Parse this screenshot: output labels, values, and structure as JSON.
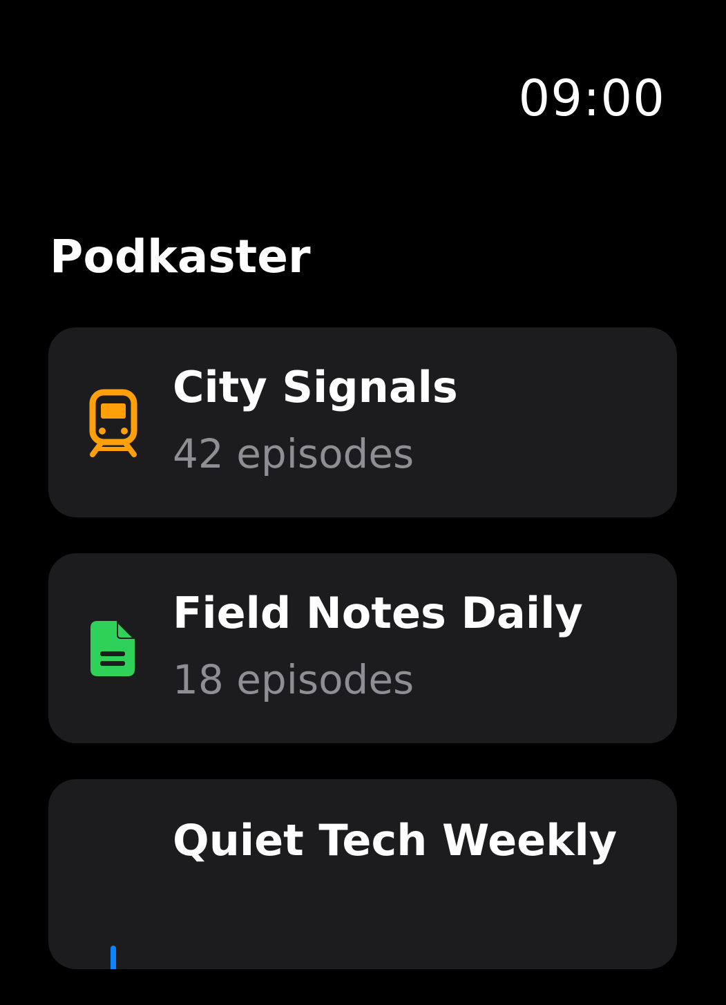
{
  "status_bar": {
    "time": "09:00"
  },
  "page": {
    "title": "Podkaster"
  },
  "podcasts": [
    {
      "title": "City Signals",
      "subtitle": "42 episodes",
      "icon": "tram-icon",
      "icon_color": "#ff9f0a"
    },
    {
      "title": "Field Notes Daily",
      "subtitle": "18 episodes",
      "icon": "document-icon",
      "icon_color": "#30d158"
    },
    {
      "title": "Quiet Tech Weekly",
      "subtitle": "",
      "icon": "podcast-icon",
      "icon_color": "#0a84ff"
    }
  ],
  "colors": {
    "background": "#000000",
    "card_background": "#1c1c1e",
    "primary_text": "#ffffff",
    "secondary_text": "#8e8e93"
  }
}
